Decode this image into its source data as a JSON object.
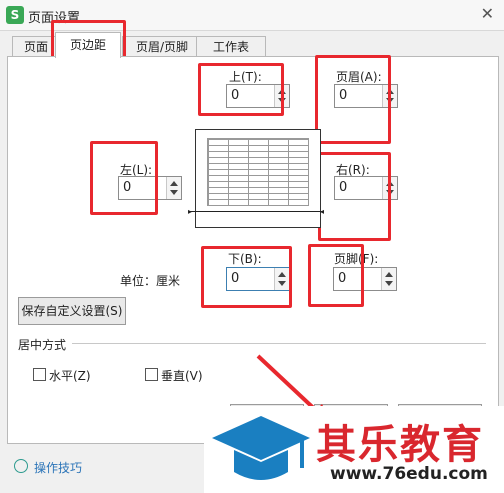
{
  "window": {
    "title": "页面设置",
    "app_icon_letter": "S"
  },
  "tabs": [
    {
      "label": "页面",
      "active": false
    },
    {
      "label": "页边距",
      "active": true
    },
    {
      "label": "页眉/页脚",
      "active": false
    },
    {
      "label": "工作表",
      "active": false
    }
  ],
  "margins": {
    "top": {
      "label": "上(T):",
      "value": "0"
    },
    "header": {
      "label": "页眉(A):",
      "value": "0"
    },
    "left": {
      "label": "左(L):",
      "value": "0"
    },
    "right": {
      "label": "右(R):",
      "value": "0"
    },
    "bottom": {
      "label": "下(B):",
      "value": "0"
    },
    "footer": {
      "label": "页脚(F):",
      "value": "0"
    }
  },
  "unit": {
    "label": "单位：",
    "value": "厘米"
  },
  "save_button": "保存自定义设置(S)",
  "center": {
    "group_label": "居中方式",
    "horizontal": {
      "label": "水平(Z)",
      "checked": false
    },
    "vertical": {
      "label": "垂直(V)",
      "checked": false
    }
  },
  "tips_link": "操作技巧",
  "watermark": {
    "brand": "其乐教育",
    "url": "www.76edu.com"
  },
  "colors": {
    "accent": "#e8282e",
    "app_green": "#3aa856",
    "logo_blue": "#1a7fc1"
  }
}
